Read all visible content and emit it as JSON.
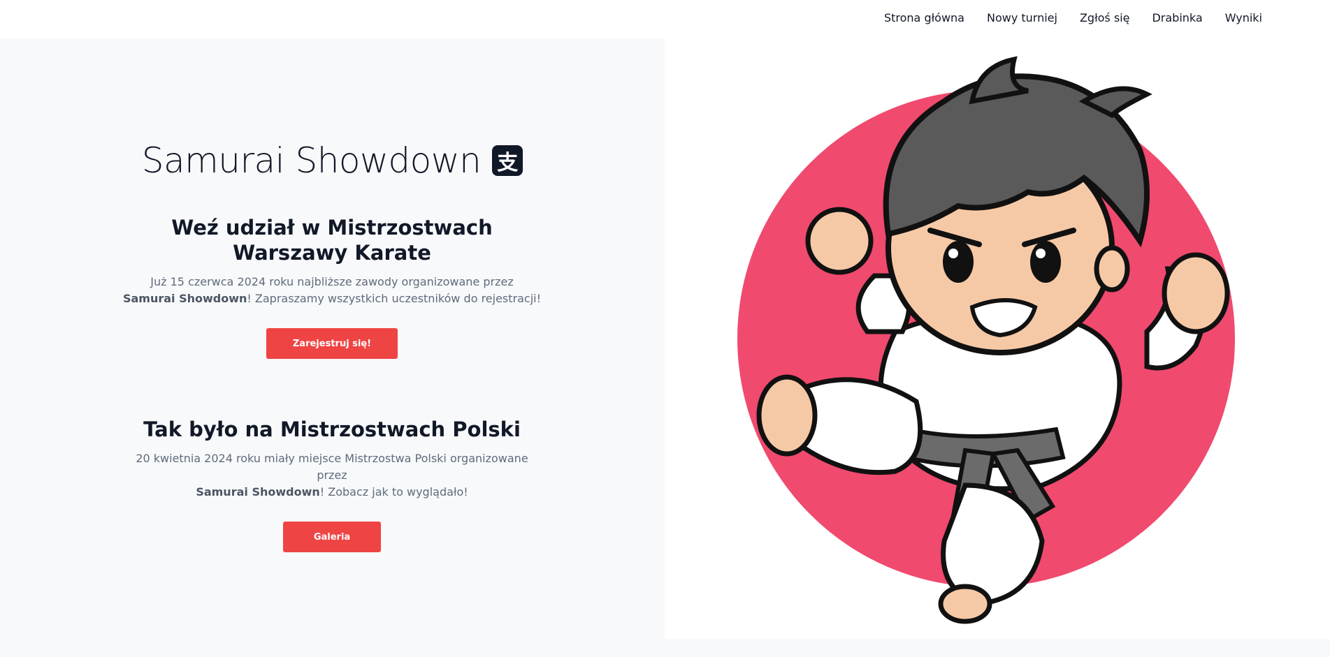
{
  "nav": {
    "items": [
      "Strona główna",
      "Nowy turniej",
      "Zgłoś się",
      "Drabinka",
      "Wyniki"
    ]
  },
  "hero": {
    "brand": "Samurai Showdown",
    "brand_icon": "支",
    "section1": {
      "heading": "Weź udział w Mistrzostwach Warszawy Karate",
      "text_before": "Już 15 czerwca 2024 roku najbliższe zawody organizowane przez",
      "brand_bold": "Samurai Showdown",
      "text_after": "! Zapraszamy wszystkich uczestników do rejestracji!",
      "button": "Zarejestruj się!"
    },
    "section2": {
      "heading": "Tak było na Mistrzostwach Polski",
      "text_before": "20 kwietnia 2024 roku miały miejsce Mistrzostwa Polski organizowane przez",
      "brand_bold": "Samurai Showdown",
      "text_after": "! Zobacz jak to wyglądało!",
      "button": "Galeria"
    }
  },
  "colors": {
    "accent": "#ef4444",
    "circle": "#f04a6e",
    "dark": "#111827"
  }
}
